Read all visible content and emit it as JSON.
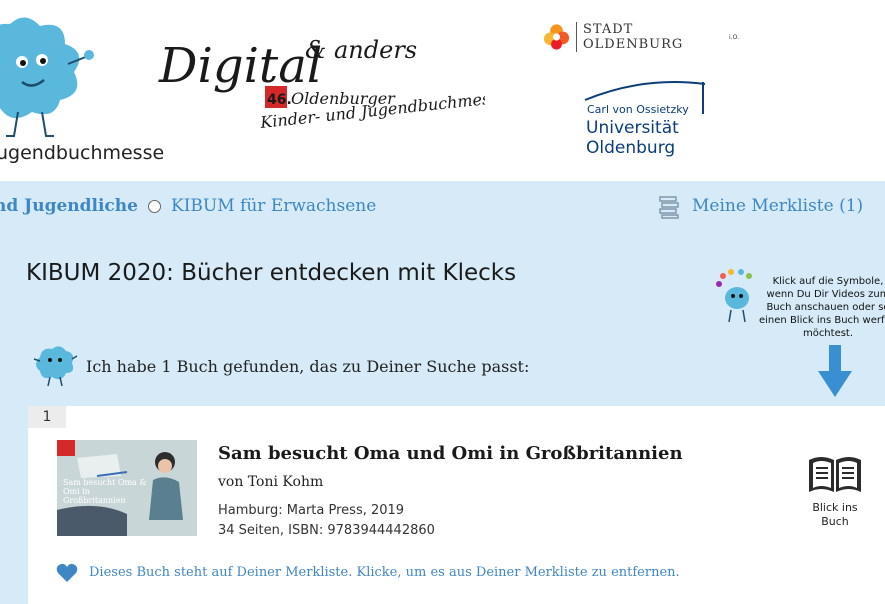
{
  "header": {
    "site_name": "ugendbuchmesse",
    "logo_text": {
      "main": "Digital",
      "amp": "& anders",
      "edition": "46.",
      "line2": "Oldenburger",
      "line3": "Kinder- und Jugendbuchmesse"
    },
    "stadt_logo": "STADT OLDENBURG",
    "stadt_suffix": "i.O.",
    "university": {
      "small": "Carl von Ossietzky",
      "line1": "Universität",
      "line2": "Oldenburg"
    }
  },
  "nav": {
    "active_label": "nd Jugendliche",
    "adults_label": "KIBUM für Erwachsene",
    "merkliste_label": "Meine Merkliste (1)"
  },
  "main": {
    "title": "KIBUM 2020: Bücher entdecken mit Klecks",
    "hint": "Klick auf die Symbole, wenn Du Dir Videos zum Buch anschauen oder so einen Blick ins Buch werfen möchtest.",
    "result_count_text": "Ich habe 1 Buch gefunden, das zu Deiner Suche passt:"
  },
  "results": [
    {
      "index": "1",
      "title": "Sam besucht Oma und Omi in Großbritannien",
      "author": "von Toni Kohm",
      "publisher": "Hamburg: Marta Press, 2019",
      "details": "34 Seiten, ISBN: 9783944442860",
      "cover_text": "Sam besucht Oma & Omi in Großbritannien",
      "action_label_1": "Blick ins",
      "action_label_2": "Buch",
      "merkliste_msg": "Dieses Buch steht auf Deiner Merkliste. Klicke, um es aus Deiner Merkliste zu entfernen."
    }
  ],
  "colors": {
    "accent": "#3e86c4",
    "band": "#d6ebf7",
    "arrow": "#3a8fd0",
    "mascot": "#5bb8dd"
  },
  "icons": [
    "mascot-icon",
    "list-icon",
    "arrow-down-icon",
    "open-book-icon",
    "heart-icon",
    "radio-icon"
  ]
}
